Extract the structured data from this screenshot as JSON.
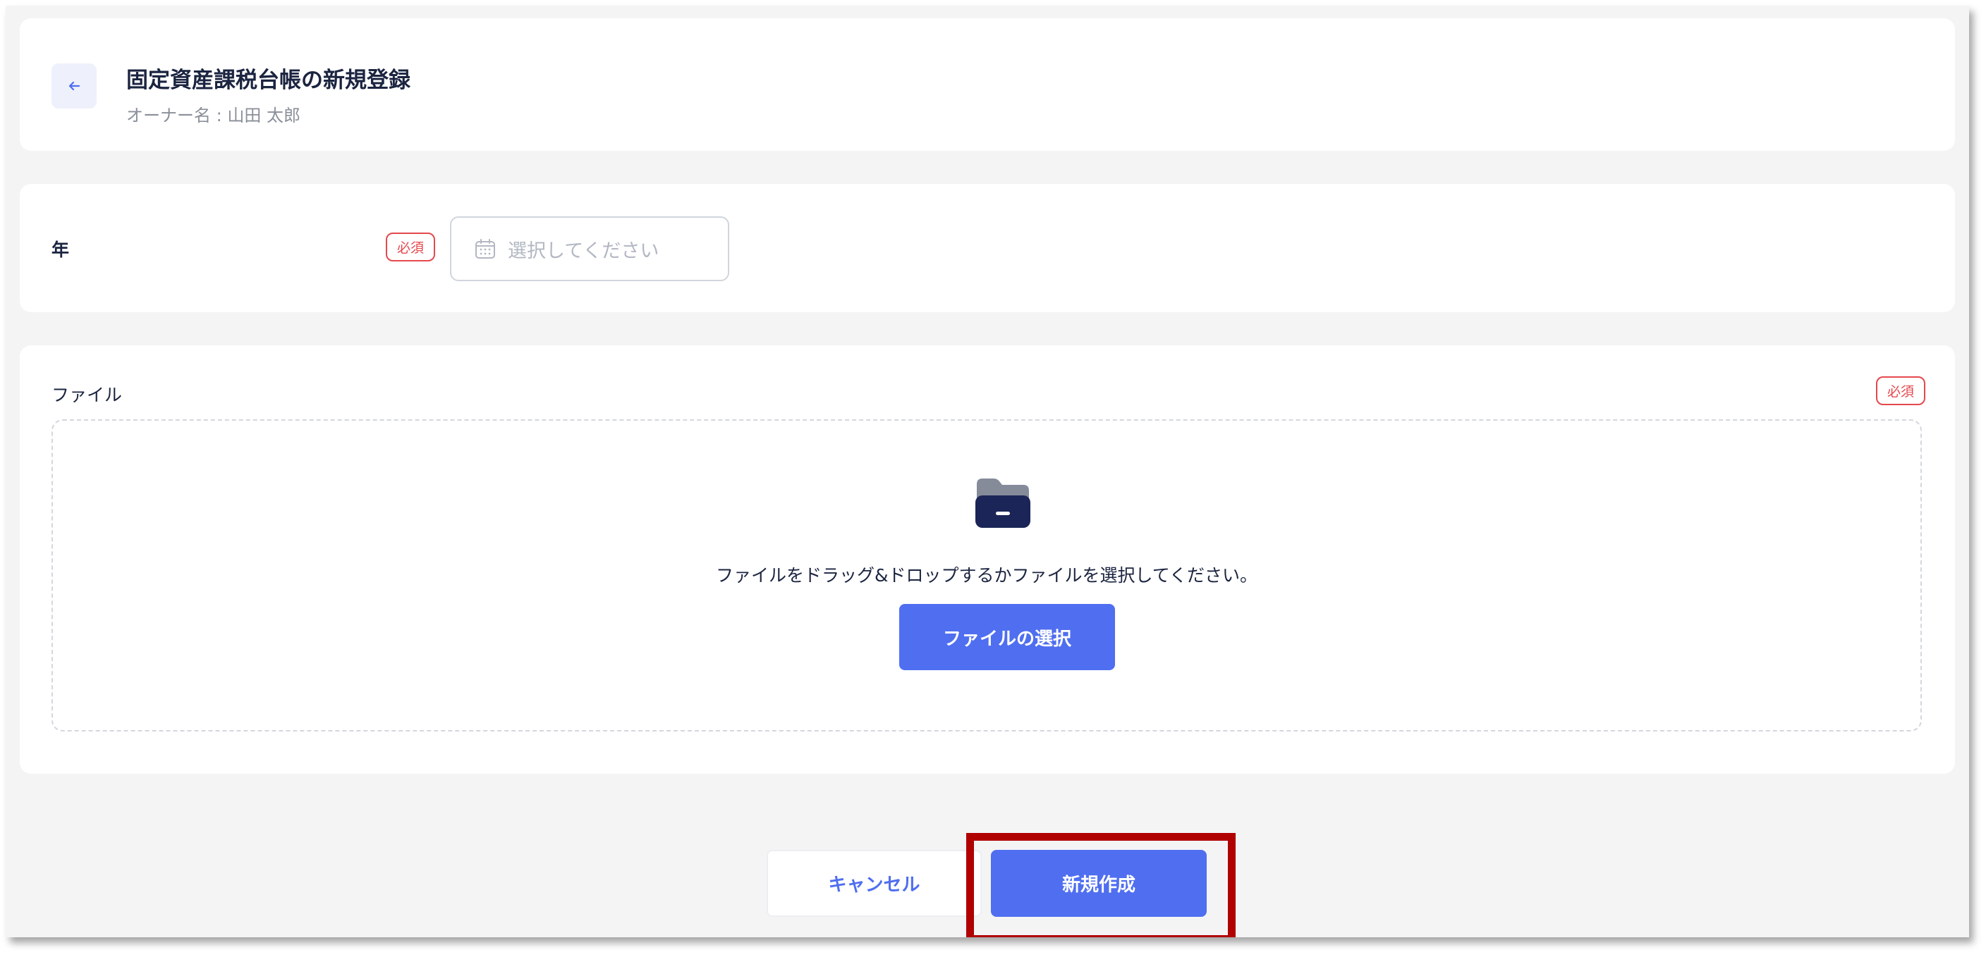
{
  "header": {
    "back_icon": "arrow-left-icon",
    "title": "固定資産課税台帳の新規登録",
    "owner": "オーナー名 : 山田 太郎"
  },
  "year_field": {
    "label": "年",
    "required_badge": "必須",
    "placeholder": "選択してください",
    "icon": "calendar-icon"
  },
  "file_field": {
    "label": "ファイル",
    "required_badge": "必須",
    "icon": "folder-icon",
    "drop_text": "ファイルをドラッグ&ドロップするかファイルを選択してください。",
    "choose_button": "ファイルの選択"
  },
  "actions": {
    "cancel": "キャンセル",
    "create": "新規作成"
  },
  "colors": {
    "primary": "#4f6ef0",
    "required": "#e5484d",
    "highlight": "#b00000",
    "background": "#f4f4f5"
  }
}
